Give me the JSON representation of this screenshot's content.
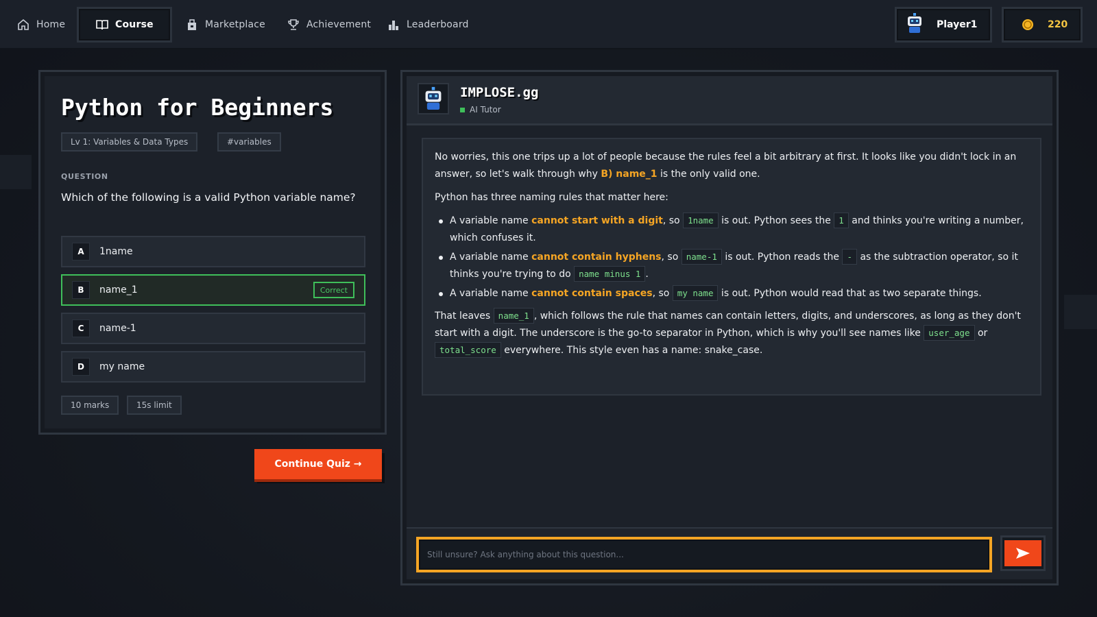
{
  "nav": {
    "items": [
      {
        "label": "Home",
        "icon": "home-icon"
      },
      {
        "label": "Course",
        "icon": "book-icon",
        "active": true
      },
      {
        "label": "Marketplace",
        "icon": "shop-icon"
      },
      {
        "label": "Achievement",
        "icon": "trophy-icon"
      },
      {
        "label": "Leaderboard",
        "icon": "bar-chart-icon"
      }
    ],
    "player": "Player1",
    "coins": "220"
  },
  "course": {
    "title": "Python for Beginners",
    "tags": [
      "Lv 1: Variables & Data Types",
      "#variables"
    ],
    "question_label": "QUESTION",
    "question": "Which of the following is a valid Python variable name?",
    "options": [
      {
        "letter": "A",
        "text": "1name"
      },
      {
        "letter": "B",
        "text": "name_1",
        "badge": "Correct"
      },
      {
        "letter": "C",
        "text": "name-1"
      },
      {
        "letter": "D",
        "text": "my name"
      }
    ],
    "meta": [
      "10 marks",
      "15s limit"
    ],
    "continue_label": "Continue Quiz →"
  },
  "tutor": {
    "name": "IMPLOSE.gg",
    "role": "AI Tutor",
    "message": {
      "p1_a": "No worries, this one trips up a lot of people because the rules feel a bit arbitrary at first. It looks like you didn't lock in an answer, so let's walk through why ",
      "p1_hl": "B) name_1",
      "p1_b": " is the only valid one.",
      "p2": "Python has three naming rules that matter here:",
      "b1_a": "A variable name ",
      "b1_hl": "cannot start with a digit",
      "b1_b": ", so ",
      "b1_code1": "1name",
      "b1_c": " is out. Python sees the ",
      "b1_code2": "1",
      "b1_d": " and thinks you're writing a number, which confuses it.",
      "b2_a": "A variable name ",
      "b2_hl": "cannot contain hyphens",
      "b2_b": ", so ",
      "b2_code1": "name-1",
      "b2_c": " is out. Python reads the ",
      "b2_code2": "-",
      "b2_d": " as the subtraction operator, so it thinks you're trying to do ",
      "b2_code3": "name minus 1",
      "b2_e": ".",
      "b3_a": "A variable name ",
      "b3_hl": "cannot contain spaces",
      "b3_b": ", so ",
      "b3_code1": "my name",
      "b3_c": " is out. Python would read that as two separate things.",
      "p3_a": "That leaves ",
      "p3_code1": "name_1",
      "p3_b": ", which follows the rule that names can contain letters, digits, and underscores, as long as they don't start with a digit. The underscore is the go-to separator in Python, which is why you'll see names like ",
      "p3_code2": "user_age",
      "p3_c": " or ",
      "p3_code3": "total_score",
      "p3_d": " everywhere. This style even has a name: snake_case."
    },
    "input_placeholder": "Still unsure? Ask anything about this question..."
  },
  "colors": {
    "accent_orange": "#f0471a",
    "highlight_yellow": "#f5a524",
    "correct_green": "#3fbf5a"
  }
}
